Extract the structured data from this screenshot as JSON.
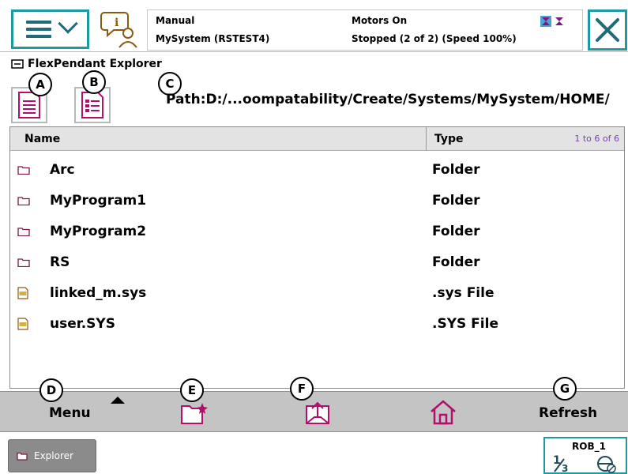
{
  "header": {
    "mode": "Manual",
    "system": "MySystem (RSTEST4)",
    "motors": "Motors On",
    "state": "Stopped (2 of 2) (Speed 100%)"
  },
  "explorer": {
    "title": "FlexPendant Explorer"
  },
  "badges": {
    "a": "A",
    "b": "B",
    "c": "C",
    "d": "D",
    "e": "E",
    "f": "F",
    "g": "G"
  },
  "path": "Path:D:/...oompatability/Create/Systems/MySystem/HOME/",
  "table": {
    "col_name": "Name",
    "col_type": "Type",
    "count": "1 to 6 of 6",
    "rows": [
      {
        "name": "Arc",
        "type": "Folder",
        "icon": "folder-icon"
      },
      {
        "name": "MyProgram1",
        "type": "Folder",
        "icon": "folder-icon"
      },
      {
        "name": "MyProgram2",
        "type": "Folder",
        "icon": "folder-icon"
      },
      {
        "name": "RS",
        "type": "Folder",
        "icon": "folder-icon"
      },
      {
        "name": "linked_m.sys",
        "type": ".sys File",
        "icon": "sys-file-icon"
      },
      {
        "name": "user.SYS",
        "type": ".SYS File",
        "icon": "sys-file-icon"
      }
    ]
  },
  "commands": {
    "menu": "Menu",
    "refresh": "Refresh"
  },
  "taskbar": {
    "explorer": "Explorer",
    "rob": "ROB_1"
  },
  "colors": {
    "accent": "#1e9aa4",
    "command_icon": "#b0106a",
    "count_text": "#7a3fb0"
  }
}
